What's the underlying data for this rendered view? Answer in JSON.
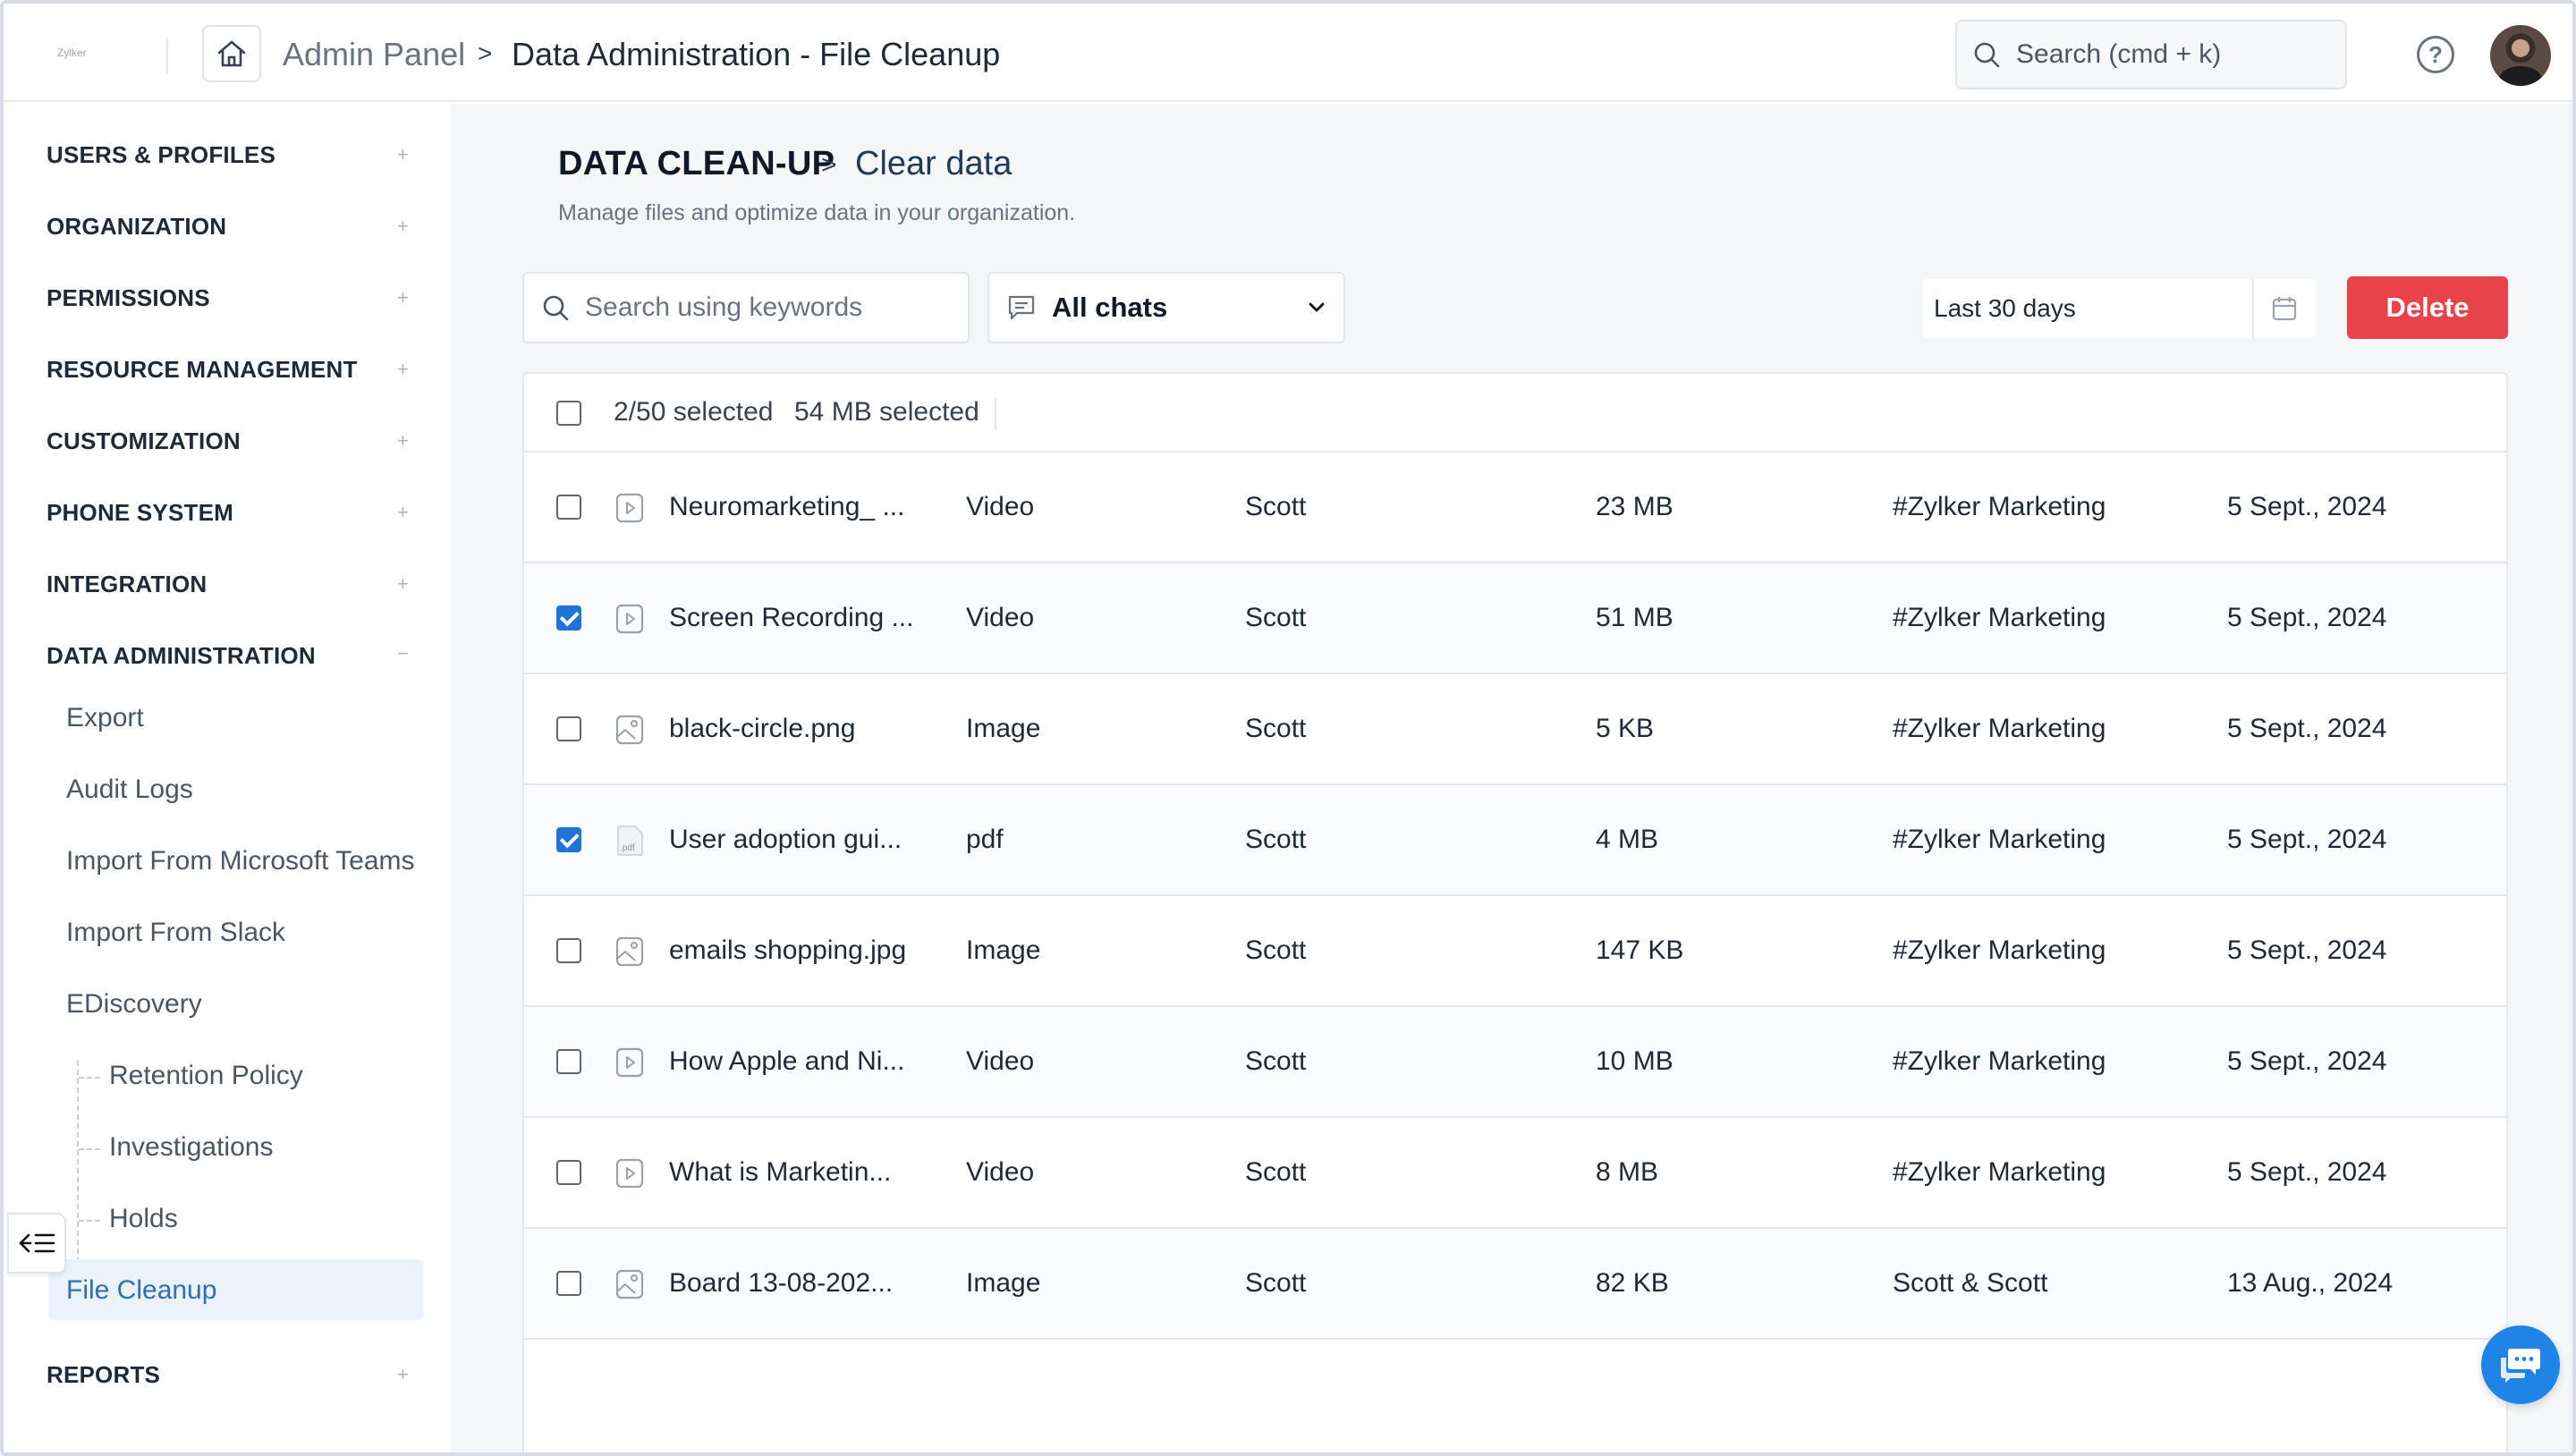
{
  "header": {
    "logo_text": "Zylker",
    "breadcrumb_root": "Admin Panel",
    "breadcrumb_sep": ">",
    "breadcrumb_current": "Data Administration - File Cleanup",
    "search_placeholder": "Search (cmd + k)",
    "help_icon": "question-circle-icon"
  },
  "sidebar": {
    "sections": [
      {
        "label": "USERS & PROFILES",
        "toggle": "+"
      },
      {
        "label": "ORGANIZATION",
        "toggle": "+"
      },
      {
        "label": "PERMISSIONS",
        "toggle": "+"
      },
      {
        "label": "RESOURCE MANAGEMENT",
        "toggle": "+"
      },
      {
        "label": "CUSTOMIZATION",
        "toggle": "+"
      },
      {
        "label": "PHONE SYSTEM",
        "toggle": "+"
      },
      {
        "label": "INTEGRATION",
        "toggle": "+"
      },
      {
        "label": "DATA ADMINISTRATION",
        "toggle": "−"
      },
      {
        "label": "REPORTS",
        "toggle": "+"
      }
    ],
    "data_admin_items": [
      "Export",
      "Audit Logs",
      "Import From Microsoft Teams",
      "Import From Slack",
      "EDiscovery"
    ],
    "ediscovery_items": [
      "Retention Policy",
      "Investigations",
      "Holds"
    ],
    "active_item": "File Cleanup",
    "collapse_icon": "collapse-sidebar-icon"
  },
  "main": {
    "title": "DATA CLEAN-UP",
    "title_sep": ">",
    "subtitle": "Clear data",
    "description": "Manage files and optimize data in your organization.",
    "keyword_search_placeholder": "Search using keywords",
    "chat_filter_value": "All chats",
    "date_range": "Last 30 days",
    "delete_label": "Delete",
    "selection_count": "2/50 selected",
    "selection_size": "54 MB selected",
    "accent_color": "#1f73d6",
    "delete_color": "#e8434a",
    "rows": [
      {
        "checked": false,
        "icon": "video-file-icon",
        "name": "Neuromarketing_ ...",
        "type": "Video",
        "owner": "Scott",
        "size": "23 MB",
        "channel": "#Zylker Marketing",
        "date": "5 Sept., 2024"
      },
      {
        "checked": true,
        "icon": "video-file-icon",
        "name": "Screen Recording ...",
        "type": "Video",
        "owner": "Scott",
        "size": "51 MB",
        "channel": "#Zylker Marketing",
        "date": "5 Sept., 2024"
      },
      {
        "checked": false,
        "icon": "image-file-icon",
        "name": "black-circle.png",
        "type": "Image",
        "owner": "Scott",
        "size": "5 KB",
        "channel": "#Zylker Marketing",
        "date": "5 Sept., 2024"
      },
      {
        "checked": true,
        "icon": "pdf-file-icon",
        "name": "User adoption gui...",
        "type": "pdf",
        "owner": "Scott",
        "size": "4 MB",
        "channel": "#Zylker Marketing",
        "date": "5 Sept., 2024"
      },
      {
        "checked": false,
        "icon": "image-file-icon",
        "name": "emails shopping.jpg",
        "type": "Image",
        "owner": "Scott",
        "size": "147 KB",
        "channel": "#Zylker Marketing",
        "date": "5 Sept., 2024"
      },
      {
        "checked": false,
        "icon": "video-file-icon",
        "name": "How Apple and Ni...",
        "type": "Video",
        "owner": "Scott",
        "size": "10 MB",
        "channel": "#Zylker Marketing",
        "date": "5 Sept., 2024"
      },
      {
        "checked": false,
        "icon": "video-file-icon",
        "name": "What is Marketin...",
        "type": "Video",
        "owner": "Scott",
        "size": "8 MB",
        "channel": "#Zylker Marketing",
        "date": "5 Sept., 2024"
      },
      {
        "checked": false,
        "icon": "image-file-icon",
        "name": "Board 13-08-202...",
        "type": "Image",
        "owner": "Scott",
        "size": "82 KB",
        "channel": "Scott & Scott",
        "date": "13 Aug., 2024"
      }
    ],
    "chat_fab_icon": "chat-bubble-icon"
  }
}
